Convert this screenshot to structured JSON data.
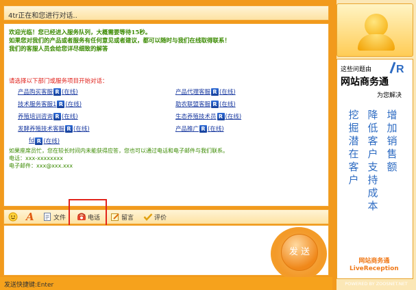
{
  "window": {
    "title": "4tr正在和您进行对话.."
  },
  "chat": {
    "welcome_lines": [
      "欢迎光临！您已经进入服务队列，大概需要等待15秒。",
      "如果您对我们的产品或者服务有任何意见或者建议，都可以随时与我们在线取得联系！",
      "我们的客服人员会给您详尽细致的解答"
    ],
    "choose_prompt": "请选择以下部门或服务项目开始对话：",
    "departments": [
      {
        "name": "产品购买客服",
        "status": "(在线)"
      },
      {
        "name": "产品代理客服",
        "status": "(在线)"
      },
      {
        "name": "技术服务客服1",
        "status": "(在线)"
      },
      {
        "name": "助农联盟客服",
        "status": "(在线)"
      },
      {
        "name": "养殖培训咨询",
        "status": "(在线)"
      },
      {
        "name": "生态养殖技术员",
        "status": "(在线)"
      },
      {
        "name": "发酵养殖技术客服",
        "status": "(在线)"
      },
      {
        "name": "产品推广",
        "status": "(在线)"
      },
      {
        "name": "fd",
        "status": "(在线)"
      }
    ],
    "contact_lines": [
      "如果座席员忙，您在较长时间内未能获得应答，您也可以通过电话和电子邮件与我们联系。",
      "电话：xxx-xxxxxxxx",
      "电子邮件：xxx@xxx.xxx"
    ]
  },
  "toolbar": {
    "emoji_icon": "smiley-icon",
    "font_icon": "font-a-icon",
    "file_label": "文件",
    "phone_label": "电话",
    "message_label": "留言",
    "rate_label": "评价"
  },
  "send_button": {
    "label": "发 送"
  },
  "status_bar": {
    "text": "发送快捷键:Enter"
  },
  "sidebar": {
    "ad_top": "这些问题由",
    "brand": "网站商务通",
    "solve": "为您解决",
    "column1": "挖掘潜在客户",
    "column2": "降低客户支持成本",
    "column3": "增加销售额",
    "bottom_brand": "网站商务通",
    "bottom_sub": "LiveReception"
  },
  "powered_by": "POWERED BY ZOOSNET.NET",
  "colors": {
    "frame": "#f6a21c",
    "welcome": "#3a8a00",
    "prompt": "#e0201a",
    "link": "#1a3aa0",
    "ad_text": "#2d6bc2"
  }
}
